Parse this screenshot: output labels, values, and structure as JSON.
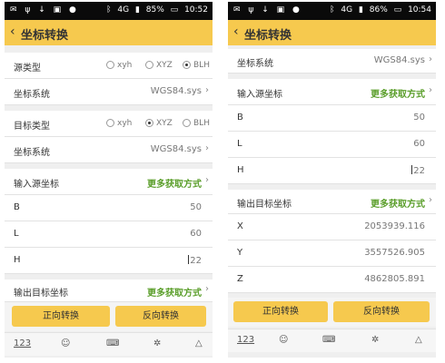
{
  "status_left_icons": "✉ ψ ↓ ▣ ●",
  "screen1": {
    "status": {
      "net": "4G",
      "battery": "85%",
      "time": "10:52"
    },
    "title": "坐标转换",
    "source_type": {
      "label": "源类型",
      "options": [
        "xyh",
        "XYZ",
        "BLH"
      ],
      "selected": "BLH"
    },
    "coord_system_label": "坐标系统",
    "coord_system_value": "WGS84.sys",
    "target_type": {
      "label": "目标类型",
      "options": [
        "xyh",
        "XYZ",
        "BLH"
      ],
      "selected": "XYZ"
    },
    "coord_system2_label": "坐标系统",
    "coord_system2_value": "WGS84.sys",
    "input_header": "输入源坐标",
    "more_link": "更多获取方式",
    "fields": [
      {
        "label": "B",
        "value": "50"
      },
      {
        "label": "L",
        "value": "60"
      },
      {
        "label": "H",
        "value": "22"
      }
    ],
    "output_header": "输出目标坐标",
    "more_link2": "更多获取方式",
    "btn_forward": "正向转换",
    "btn_reverse": "反向转换",
    "kb_num": "123"
  },
  "screen2": {
    "status": {
      "net": "4G",
      "battery": "86%",
      "time": "10:54"
    },
    "title": "坐标转换",
    "coord_system_label": "坐标系统",
    "coord_system_value": "WGS84.sys",
    "input_header": "输入源坐标",
    "more_link": "更多获取方式",
    "fields": [
      {
        "label": "B",
        "value": "50"
      },
      {
        "label": "L",
        "value": "60"
      },
      {
        "label": "H",
        "value": "22"
      }
    ],
    "output_header": "输出目标坐标",
    "more_link2": "更多获取方式",
    "outputs": [
      {
        "label": "X",
        "value": "2053939.116"
      },
      {
        "label": "Y",
        "value": "3557526.905"
      },
      {
        "label": "Z",
        "value": "4862805.891"
      }
    ],
    "btn_forward": "正向转换",
    "btn_reverse": "反向转换",
    "kb_num": "123"
  }
}
